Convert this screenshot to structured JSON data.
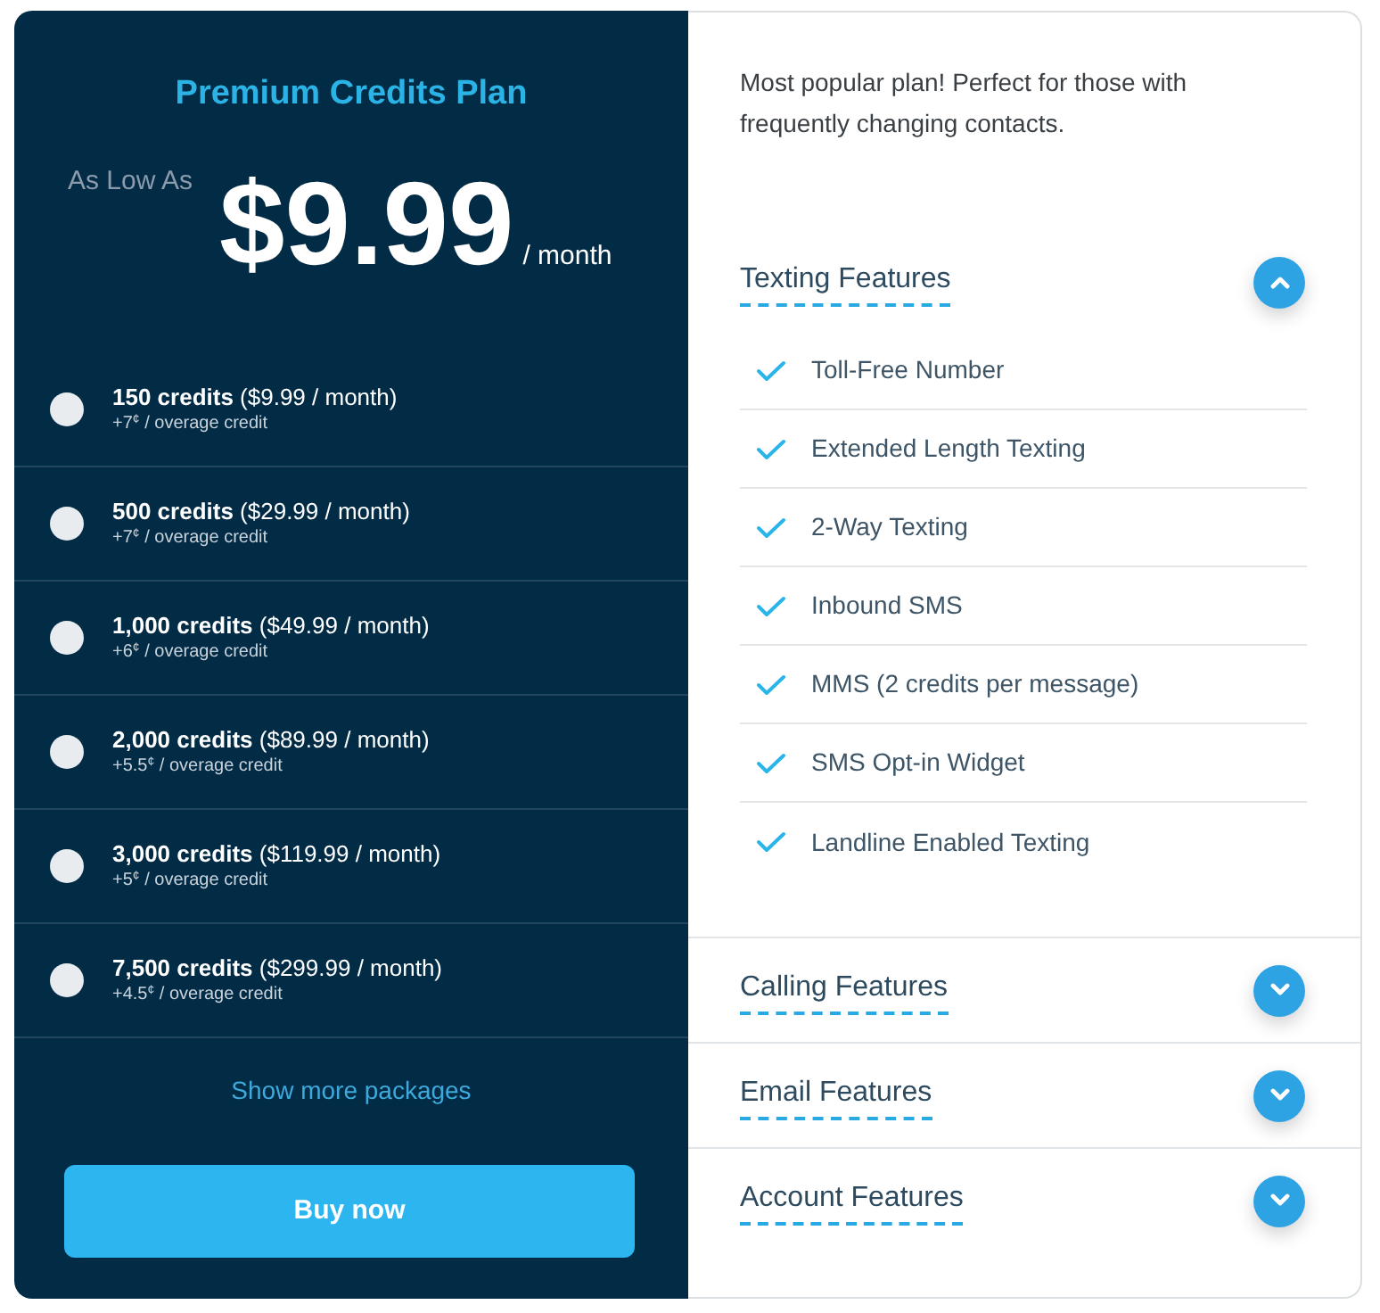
{
  "plan": {
    "title": "Premium Credits Plan",
    "price_prefix": "As Low As",
    "price": "$9.99",
    "period": "/ month"
  },
  "packages": [
    {
      "label": "**150 credits** ($9.99 / month)",
      "overage": "+7$^{¢}$ / overage credit",
      "selected": false
    },
    {
      "label": "**500 credits** ($29.99 / month)",
      "overage": "+7$^{¢}$ / overage credit",
      "selected": false
    },
    {
      "label": "**1,000 credits** ($49.99 / month)",
      "overage": "+6$^{¢}$ / overage credit",
      "selected": false
    },
    {
      "label": "**2,000 credits** ($89.99 / month)",
      "overage": "+5.5$^{¢}$ / overage credit",
      "selected": false
    },
    {
      "label": "**3,000 credits** ($119.99 / month)",
      "overage": "+5$^{¢}$ / overage credit",
      "selected": false
    },
    {
      "label": "**7,500 credits** ($299.99 / month)",
      "overage": "+4.5$^{¢}$ / overage credit",
      "selected": false
    }
  ],
  "show_more": "Show more packages",
  "buy_button": "Buy now",
  "description": "Most popular plan! Perfect for those with frequently changing contacts.",
  "feature_sections": [
    {
      "title": "Texting Features",
      "expanded": true,
      "features": [
        "Toll-Free Number",
        "Extended Length Texting",
        "2-Way Texting",
        "Inbound SMS",
        "MMS (2 credits per message)",
        "SMS Opt-in Widget",
        "Landline Enabled Texting"
      ]
    },
    {
      "title": "Calling Features",
      "expanded": false
    },
    {
      "title": "Email Features",
      "expanded": false
    },
    {
      "title": "Account Features",
      "expanded": false
    }
  ]
}
